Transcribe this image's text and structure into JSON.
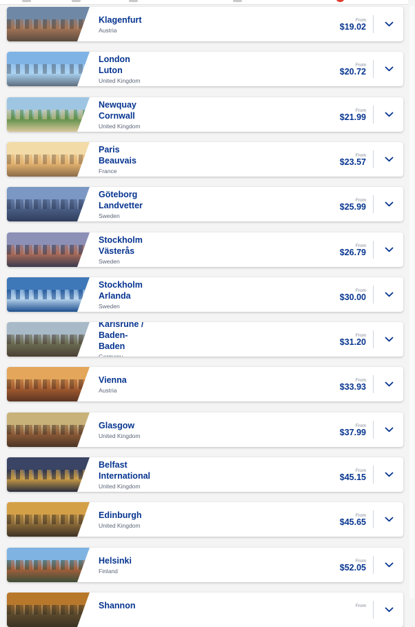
{
  "destinations": [
    {
      "city": "Klagenfurt",
      "country": "Austria",
      "from_label": "From",
      "price": "$19.02",
      "colors": [
        "#6f88a6",
        "#a37456",
        "#5a4b40"
      ]
    },
    {
      "city": "London\nLuton",
      "country": "United Kingdom",
      "from_label": "From",
      "price": "$20.72",
      "colors": [
        "#7fb3e6",
        "#a9d2f2",
        "#5e6e7e"
      ]
    },
    {
      "city": "Newquay\nCornwall",
      "country": "United Kingdom",
      "from_label": "From",
      "price": "$21.99",
      "colors": [
        "#9ec6e3",
        "#5e8f4a",
        "#d8c79a"
      ]
    },
    {
      "city": "Paris\nBeauvais",
      "country": "France",
      "from_label": "From",
      "price": "$23.57",
      "colors": [
        "#f3dba7",
        "#e3b26f",
        "#8b6c4a"
      ]
    },
    {
      "city": "Göteborg\nLandvetter",
      "country": "Sweden",
      "from_label": "From",
      "price": "$25.99",
      "colors": [
        "#7b97c4",
        "#4b5f86",
        "#2f3e5d"
      ]
    },
    {
      "city": "Stockholm\nVästerås",
      "country": "Sweden",
      "from_label": "From",
      "price": "$26.79",
      "colors": [
        "#8c8fb6",
        "#a86a58",
        "#3b3b4e"
      ]
    },
    {
      "city": "Stockholm\nArlanda",
      "country": "Sweden",
      "from_label": "From",
      "price": "$30.00",
      "colors": [
        "#3f78b9",
        "#b9d5ee",
        "#1e4f8f"
      ]
    },
    {
      "city": "Karlsruhe /\nBaden-\nBaden",
      "country": "Germany",
      "from_label": "From",
      "price": "$31.20",
      "colors": [
        "#a8b9c8",
        "#6a6b52",
        "#4a3f33"
      ]
    },
    {
      "city": "Vienna",
      "country": "Austria",
      "from_label": "From",
      "price": "$33.93",
      "colors": [
        "#e4a65a",
        "#a35b2f",
        "#5c3523"
      ]
    },
    {
      "city": "Glasgow",
      "country": "United Kingdom",
      "from_label": "From",
      "price": "$37.99",
      "colors": [
        "#c9b27a",
        "#8a5a36",
        "#4b3426"
      ]
    },
    {
      "city": "Belfast\nInternational",
      "country": "United Kingdom",
      "from_label": "From",
      "price": "$45.15",
      "colors": [
        "#3a4464",
        "#c99b45",
        "#2a2e3f"
      ]
    },
    {
      "city": "Edinburgh",
      "country": "United Kingdom",
      "from_label": "From",
      "price": "$45.65",
      "colors": [
        "#d4a047",
        "#8b6a37",
        "#3e3225"
      ]
    },
    {
      "city": "Helsinki",
      "country": "Finland",
      "from_label": "From",
      "price": "$52.05",
      "colors": [
        "#7fb4e2",
        "#a35f3b",
        "#3d4f3a"
      ]
    },
    {
      "city": "Shannon",
      "country": "",
      "from_label": "From",
      "price": "",
      "colors": [
        "#b7782c",
        "#5d4a2c",
        "#3a3324"
      ]
    }
  ],
  "colors": {
    "brand_text": "#073590",
    "muted_text": "#5b6577"
  },
  "icons": {
    "expand": "chevron-down-icon"
  }
}
